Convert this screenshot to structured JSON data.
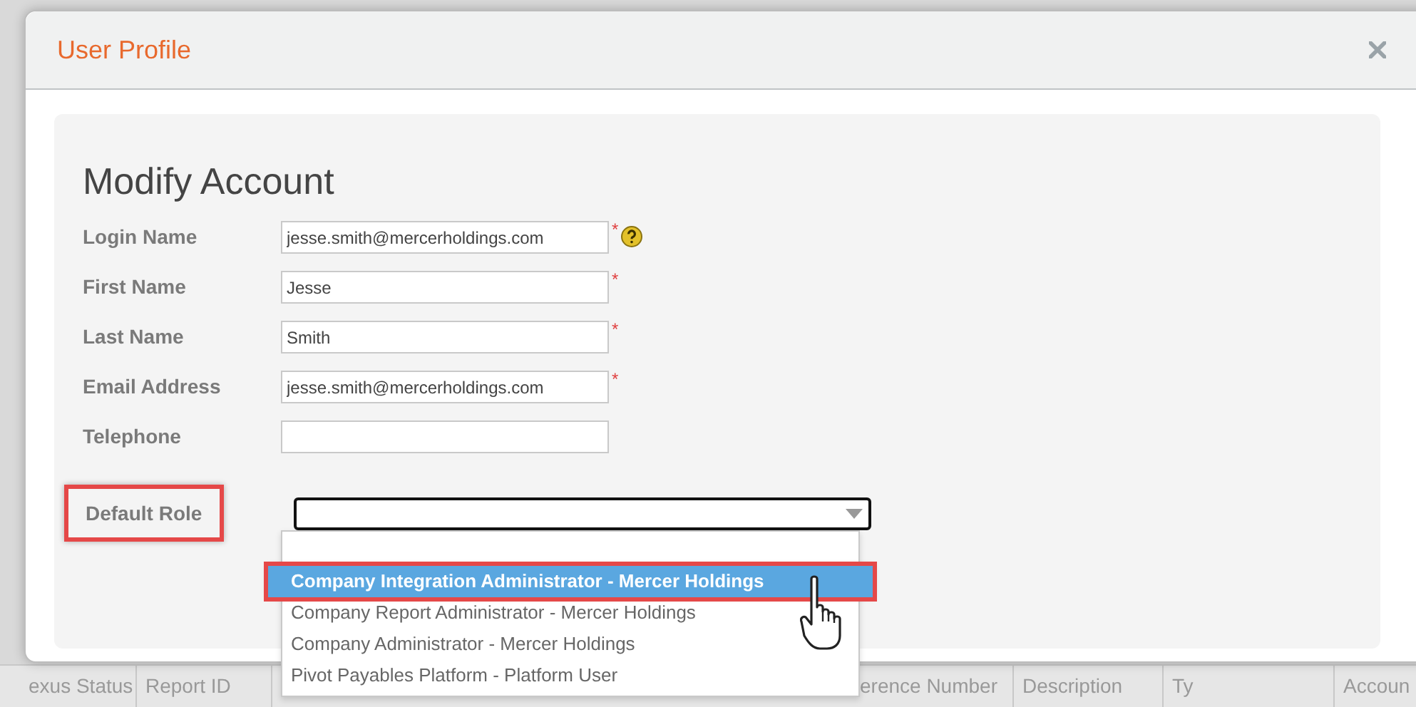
{
  "background_table": {
    "columns": [
      "exus Status",
      "Report ID",
      "erence Number",
      "Description",
      "Ty",
      "Accoun"
    ]
  },
  "dialog": {
    "title": "User Profile",
    "heading": "Modify Account",
    "fields": [
      {
        "label": "Login Name",
        "value": "jesse.smith@mercerholdings.com",
        "required_mark": "*",
        "help": true
      },
      {
        "label": "First Name",
        "value": "Jesse",
        "required_mark": "*",
        "help": false
      },
      {
        "label": "Last Name",
        "value": "Smith",
        "required_mark": "*",
        "help": false
      },
      {
        "label": "Email Address",
        "value": "jesse.smith@mercerholdings.com",
        "required_mark": "*",
        "help": false
      },
      {
        "label": "Telephone",
        "help": false
      }
    ],
    "default_role": {
      "label": "Default Role",
      "highlighted": true,
      "expanded": true,
      "options": [
        {
          "label": "Company Integration Administrator - Mercer Holdings",
          "selected": true,
          "highlighted": true
        },
        {
          "label": "Company Report Administrator - Mercer Holdings",
          "selected": false,
          "highlighted": false
        },
        {
          "label": "Company Administrator - Mercer Holdings",
          "selected": false,
          "highlighted": false
        },
        {
          "label": "Pivot Payables Platform - Platform User",
          "selected": false,
          "highlighted": false
        }
      ]
    }
  }
}
